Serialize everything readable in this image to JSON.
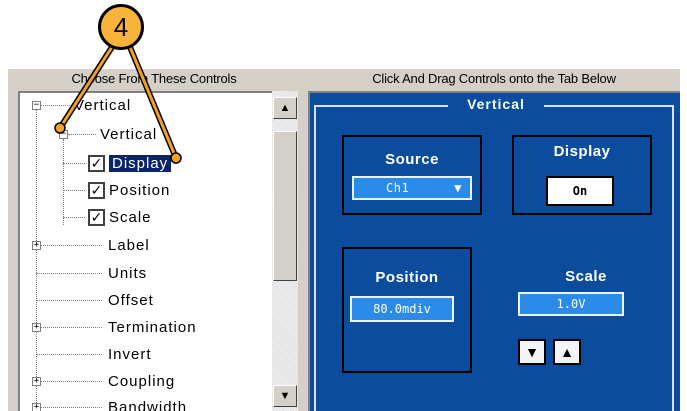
{
  "callout": {
    "number": "4"
  },
  "left_header": "Choose From These Controls",
  "right_header": "Click And Drag Controls onto the Tab Below",
  "tree": {
    "root": "Vertical",
    "child": "Vertical",
    "checked_items": [
      "Display",
      "Position",
      "Scale"
    ],
    "selected_item": "Display",
    "other_items": [
      "Label",
      "Units",
      "Offset",
      "Termination",
      "Invert",
      "Coupling",
      "Bandwidth"
    ]
  },
  "panel": {
    "title": "Vertical",
    "source": {
      "label": "Source",
      "value": "Ch1"
    },
    "display": {
      "label": "Display",
      "value": "On"
    },
    "position": {
      "label": "Position",
      "value": "80.0mdiv"
    },
    "scale": {
      "label": "Scale",
      "value": "1.0V"
    }
  },
  "colors": {
    "panel_blue": "#0b4d9c",
    "field_blue": "#2b8be8",
    "callout_orange": "#f8b43a",
    "callout_line": "#f4a020"
  }
}
